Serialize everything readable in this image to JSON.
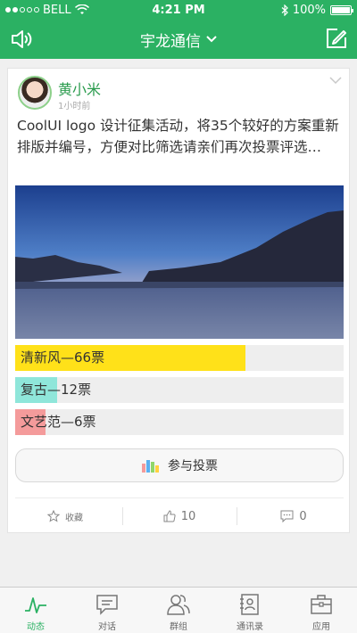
{
  "status": {
    "carrier": "BELL",
    "time": "4:21 PM",
    "battery": "100%"
  },
  "header": {
    "title": "宇龙通信"
  },
  "post": {
    "author": "黄小米",
    "time": "1小时前",
    "text": " CoolUI logo 设计征集活动，将35个较好的方案重新排版并编号，方便对比筛选请亲们再次投票评选…",
    "options": [
      {
        "label": "清新风—66票",
        "votes": 66,
        "color": "#ffe119"
      },
      {
        "label": "复古—12票",
        "votes": 12,
        "color": "#8fe6da"
      },
      {
        "label": "文艺范—6票",
        "votes": 6,
        "color": "#f49b9b"
      }
    ],
    "vote_button": "参与投票",
    "actions": {
      "favorite": "收藏",
      "likes": "10",
      "comments": "0"
    }
  },
  "tabs": [
    {
      "label": "动态",
      "icon": "pulse-icon"
    },
    {
      "label": "对话",
      "icon": "chat-icon"
    },
    {
      "label": "群组",
      "icon": "group-icon"
    },
    {
      "label": "通讯录",
      "icon": "contacts-icon"
    },
    {
      "label": "应用",
      "icon": "briefcase-icon"
    }
  ],
  "colors": {
    "brand": "#2bb163"
  }
}
